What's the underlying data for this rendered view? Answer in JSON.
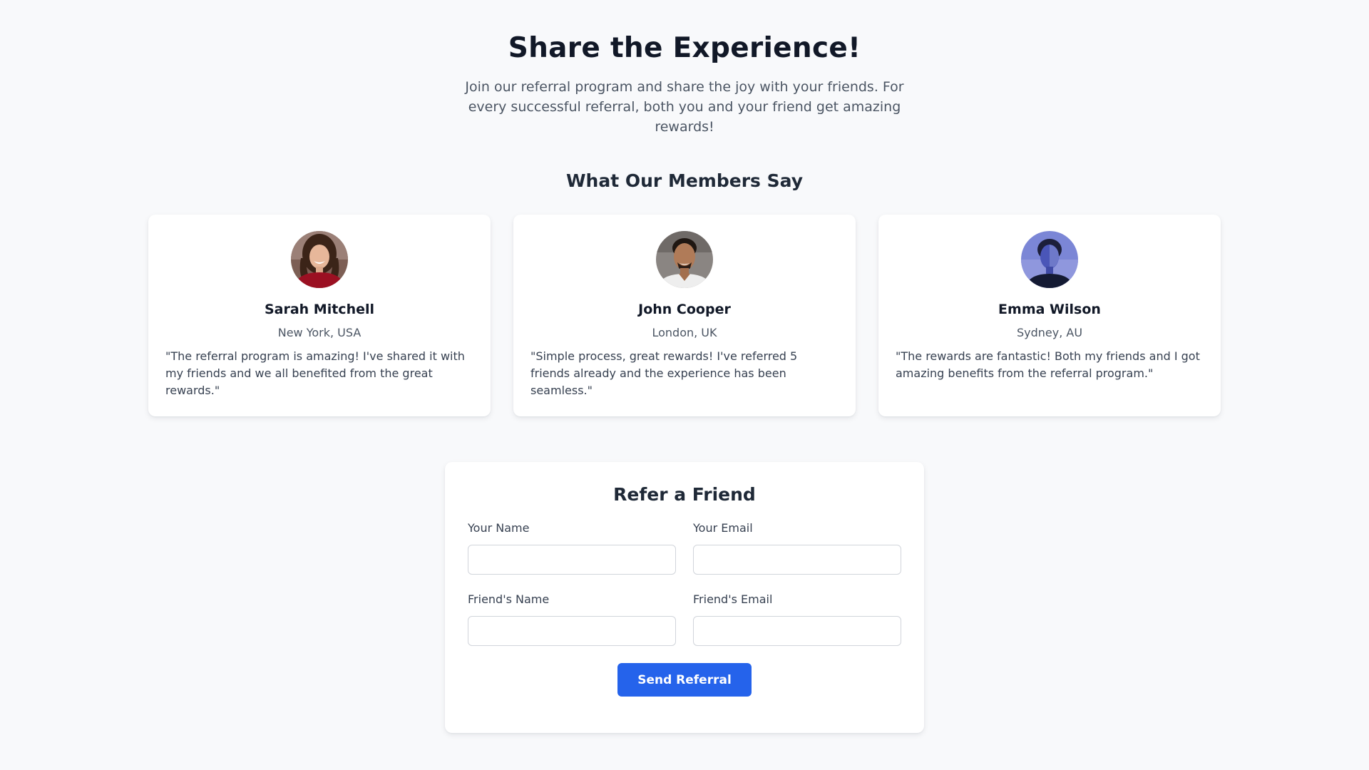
{
  "hero": {
    "title": "Share the Experience!",
    "subtitle": "Join our referral program and share the joy with your friends. For every successful referral, both you and your friend get amazing rewards!"
  },
  "testimonials": {
    "title": "What Our Members Say",
    "items": [
      {
        "name": "Sarah Mitchell",
        "location": "New York, USA",
        "quote": "\"The referral program is amazing! I've shared it with my friends and we all benefited from the great rewards.\"",
        "avatar": "woman-red-sweater-photo"
      },
      {
        "name": "John Cooper",
        "location": "London, UK",
        "quote": "\"Simple process, great rewards! I've referred 5 friends already and the experience has been seamless.\"",
        "avatar": "man-white-tshirt-photo"
      },
      {
        "name": "Emma Wilson",
        "location": "Sydney, AU",
        "quote": "\"The rewards are fantastic! Both my friends and I got amazing benefits from the referral program.\"",
        "avatar": "woman-blue-light-photo"
      }
    ]
  },
  "form": {
    "title": "Refer a Friend",
    "your_name_label": "Your Name",
    "your_name_value": "",
    "your_email_label": "Your Email",
    "your_email_value": "",
    "friend_name_label": "Friend's Name",
    "friend_name_value": "",
    "friend_email_label": "Friend's Email",
    "friend_email_value": "",
    "submit_label": "Send Referral"
  },
  "colors": {
    "background": "#f8f9fb",
    "primary_button": "#2563eb",
    "heading": "#111827",
    "body_text": "#4b5563"
  }
}
